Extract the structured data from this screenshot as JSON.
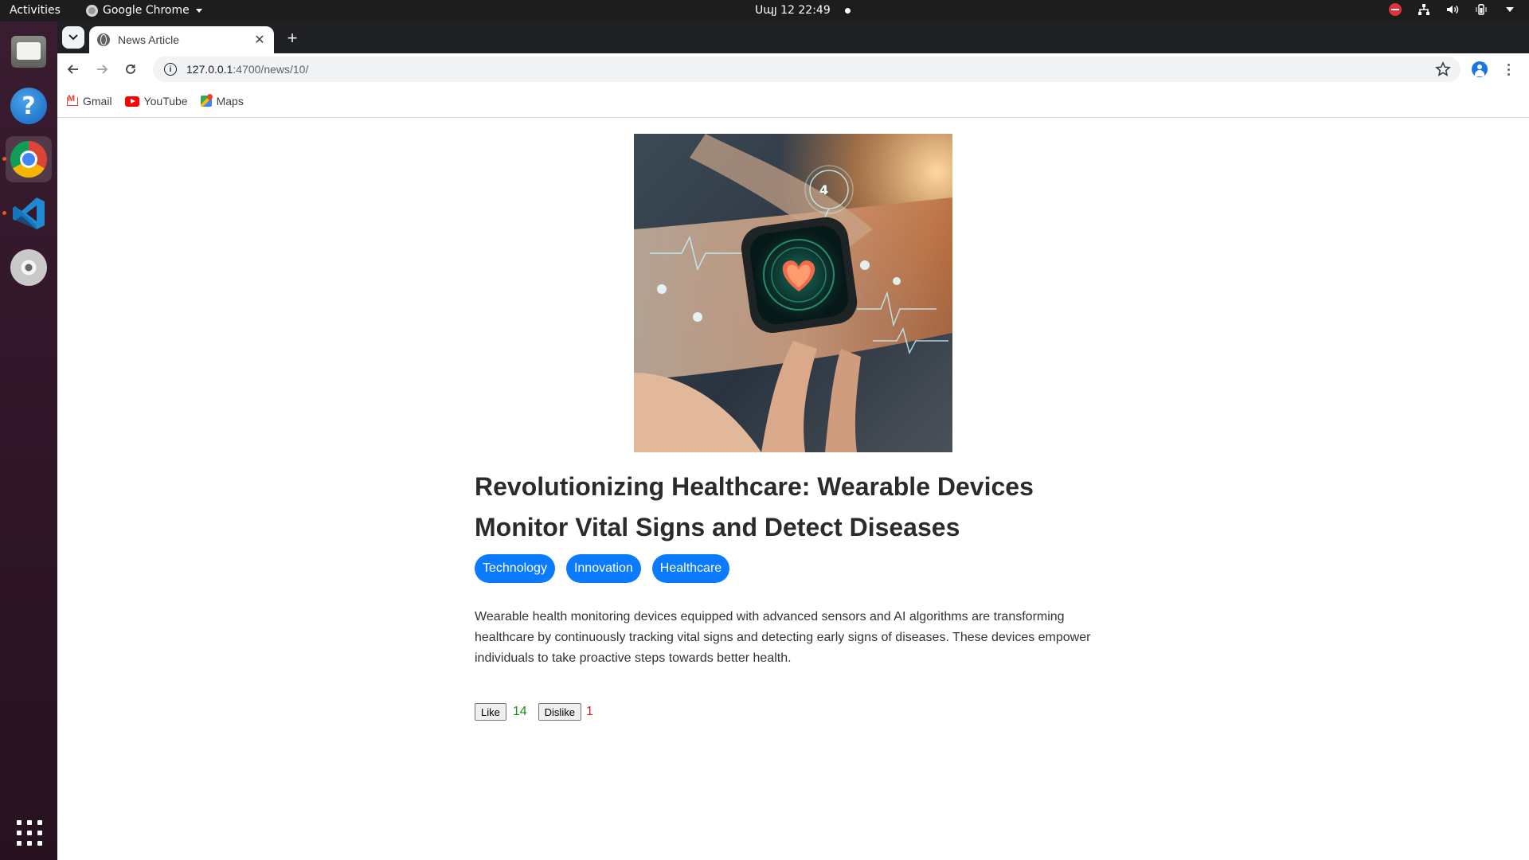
{
  "system_bar": {
    "activities": "Activities",
    "app_name": "Google Chrome",
    "clock": "Սպյ 12  22:49"
  },
  "dock": {
    "items": [
      "Files",
      "Help",
      "Google Chrome",
      "Visual Studio Code",
      "DVD Drive"
    ],
    "show_apps": "Show Applications"
  },
  "browser": {
    "tab_title": "News Article",
    "url_host": "127.0.0.1",
    "url_path": ":4700/news/10/",
    "bookmarks": [
      {
        "label": "Gmail",
        "icon": "gmail-icon"
      },
      {
        "label": "YouTube",
        "icon": "youtube-icon"
      },
      {
        "label": "Maps",
        "icon": "maps-icon"
      }
    ]
  },
  "article": {
    "image_subject": "smartwatch-heart-monitor",
    "title": "Revolutionizing Healthcare: Wearable Devices Monitor Vital Signs and Detect Diseases",
    "tags": [
      "Technology",
      "Innovation",
      "Healthcare"
    ],
    "body": "Wearable health monitoring devices equipped with advanced sensors and AI algorithms are transforming healthcare by continuously tracking vital signs and detecting early signs of diseases. These devices empower individuals to take proactive steps towards better health.",
    "like_label": "Like",
    "like_count": "14",
    "dislike_label": "Dislike",
    "dislike_count": "1"
  },
  "colors": {
    "tag_bg": "#0a7bff",
    "like_count": "#1a8f1a",
    "dislike_count": "#d02020",
    "topbar_bg": "#1d1d1d",
    "dock_bg": "#2d1526"
  }
}
